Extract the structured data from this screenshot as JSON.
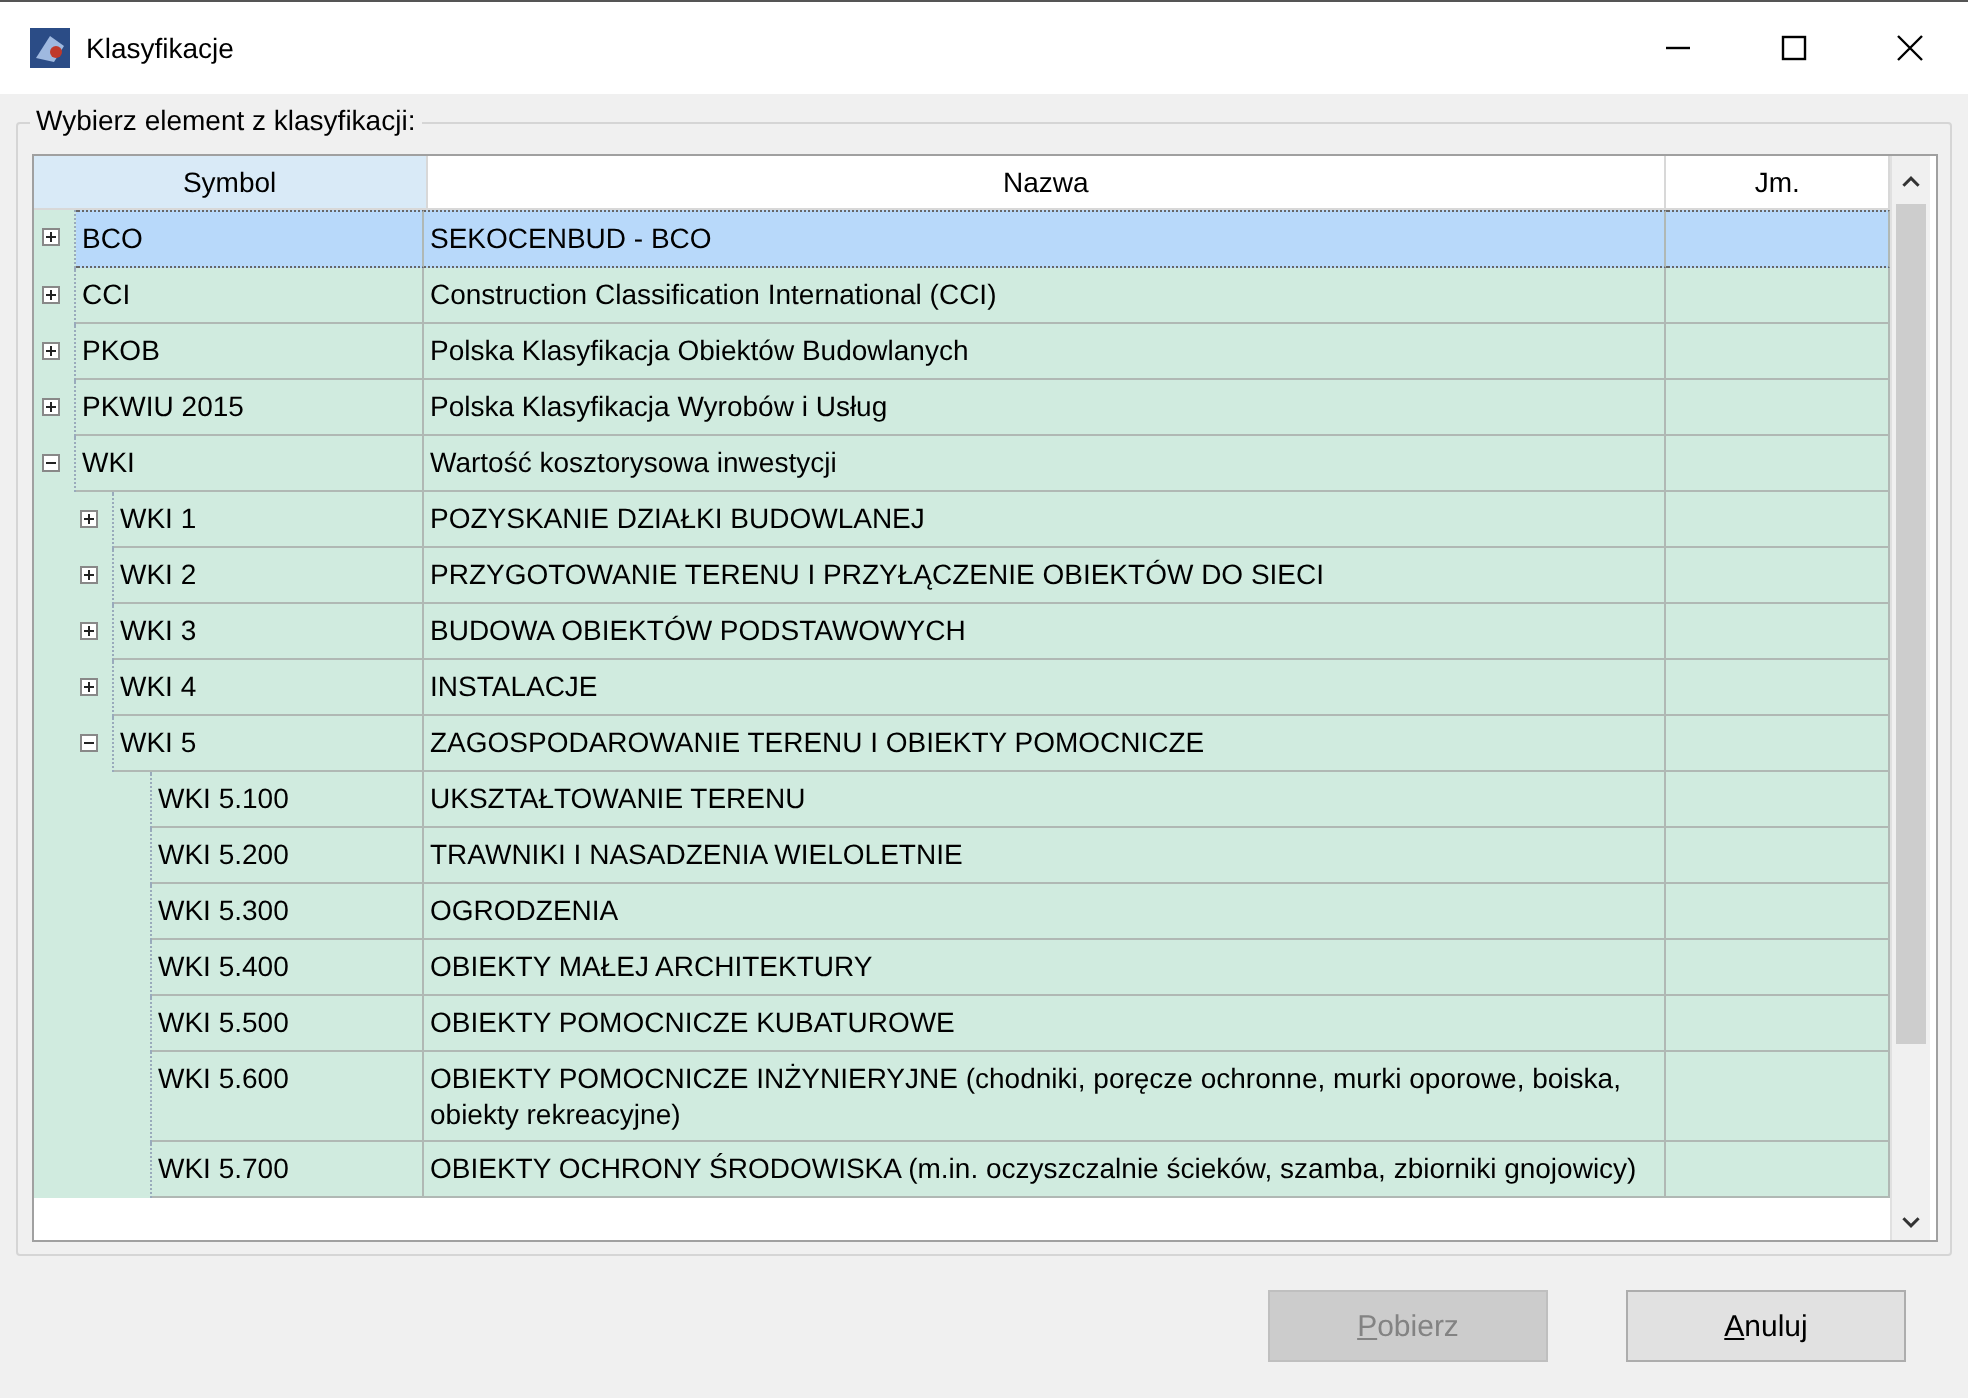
{
  "window": {
    "title": "Klasyfikacje"
  },
  "group": {
    "label": "Wybierz element z klasyfikacji:"
  },
  "table": {
    "columns": [
      {
        "label": "Symbol",
        "sorted": true
      },
      {
        "label": "Nazwa",
        "sorted": false
      },
      {
        "label": "Jm.",
        "sorted": false
      }
    ],
    "rows": [
      {
        "symbol": "BCO",
        "name": "SEKOCENBUD - BCO",
        "selected": true,
        "expanded": false
      },
      {
        "symbol": "CCI",
        "name": "Construction Classification International (CCI)",
        "selected": false,
        "expanded": false
      },
      {
        "symbol": "PKOB",
        "name": "Polska Klasyfikacja Obiektów Budowlanych",
        "selected": false,
        "expanded": false
      },
      {
        "symbol": "PKWIU 2015",
        "name": "Polska Klasyfikacja Wyrobów i Usług",
        "selected": false,
        "expanded": false
      },
      {
        "symbol": "WKI",
        "name": "Wartość kosztorysowa inwestycji",
        "selected": false,
        "expanded": true,
        "children": [
          {
            "symbol": "WKI 1",
            "name": "POZYSKANIE DZIAŁKI BUDOWLANEJ",
            "selected": false,
            "expanded": false
          },
          {
            "symbol": "WKI 2",
            "name": "PRZYGOTOWANIE TERENU I PRZYŁĄCZENIE OBIEKTÓW DO SIECI",
            "selected": false,
            "expanded": false
          },
          {
            "symbol": "WKI 3",
            "name": "BUDOWA OBIEKTÓW PODSTAWOWYCH",
            "selected": false,
            "expanded": false
          },
          {
            "symbol": "WKI 4",
            "name": "INSTALACJE",
            "selected": false,
            "expanded": false
          },
          {
            "symbol": "WKI 5",
            "name": "ZAGOSPODAROWANIE TERENU I OBIEKTY POMOCNICZE",
            "selected": false,
            "expanded": true,
            "children": [
              {
                "symbol": "WKI 5.100",
                "name": "UKSZTAŁTOWANIE TERENU",
                "selected": false
              },
              {
                "symbol": "WKI 5.200",
                "name": "TRAWNIKI I NASADZENIA WIELOLETNIE",
                "selected": false
              },
              {
                "symbol": "WKI 5.300",
                "name": "OGRODZENIA",
                "selected": false
              },
              {
                "symbol": "WKI 5.400",
                "name": "OBIEKTY MAŁEJ ARCHITEKTURY",
                "selected": false
              },
              {
                "symbol": "WKI 5.500",
                "name": "OBIEKTY POMOCNICZE KUBATUROWE",
                "selected": false
              },
              {
                "symbol": "WKI 5.600",
                "name": "OBIEKTY POMOCNICZE INŻYNIERYJNE (chodniki, poręcze ochronne, murki oporowe, boiska, obiekty rekreacyjne)",
                "selected": false
              },
              {
                "symbol": "WKI 5.700",
                "name": "OBIEKTY OCHRONY ŚRODOWISKA (m.in. oczyszczalnie ścieków, szamba, zbiorniki gnojowicy)",
                "selected": false
              }
            ]
          }
        ]
      }
    ]
  },
  "buttons": [
    {
      "label": "Pobierz",
      "disabled": true
    },
    {
      "label": "Anuluj",
      "disabled": false
    }
  ]
}
